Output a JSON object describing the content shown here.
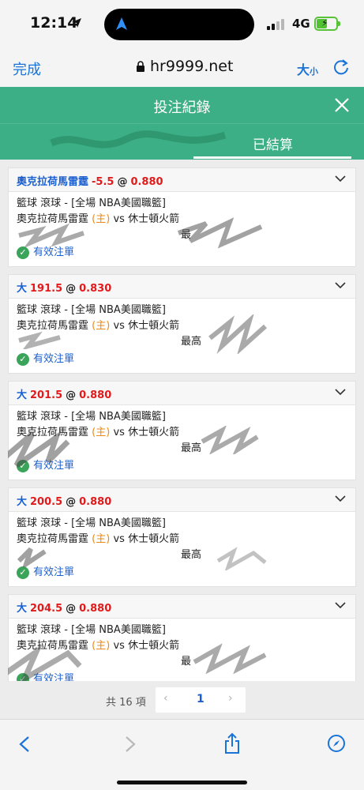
{
  "status": {
    "time": "12:14",
    "network": "4G"
  },
  "browser": {
    "done_label": "完成",
    "url": "hr9999.net",
    "text_size_big": "大",
    "text_size_small": "小"
  },
  "modal": {
    "title": "投注紀錄"
  },
  "tabs": {
    "unsettled": "",
    "settled": "已結算"
  },
  "bets": [
    {
      "pick": "奧克拉荷馬雷霆",
      "line": "-5.5",
      "at": "@",
      "odds": "0.880",
      "league": "籃球 滾球 - [全場 NBA美國職籃]",
      "home": "奧克拉荷馬雷霆",
      "home_tag": "(主)",
      "vs": "vs",
      "away": "休士頓火箭",
      "max": "最",
      "status": "有效注單"
    },
    {
      "pick": "大",
      "line": "191.5",
      "at": "@",
      "odds": "0.830",
      "league": "籃球 滾球 - [全場 NBA美國職籃]",
      "home": "奧克拉荷馬雷霆",
      "home_tag": "(主)",
      "vs": "vs",
      "away": "休士頓火箭",
      "max": "最高",
      "status": "有效注單"
    },
    {
      "pick": "大",
      "line": "201.5",
      "at": "@",
      "odds": "0.880",
      "league": "籃球 滾球 - [全場 NBA美國職籃]",
      "home": "奧克拉荷馬雷霆",
      "home_tag": "(主)",
      "vs": "vs",
      "away": "休士頓火箭",
      "max": "最高",
      "status": "有效注單"
    },
    {
      "pick": "大",
      "line": "200.5",
      "at": "@",
      "odds": "0.880",
      "league": "籃球 滾球 - [全場 NBA美國職籃]",
      "home": "奧克拉荷馬雷霆",
      "home_tag": "(主)",
      "vs": "vs",
      "away": "休士頓火箭",
      "max": "最高",
      "status": "有效注單"
    },
    {
      "pick": "大",
      "line": "204.5",
      "at": "@",
      "odds": "0.880",
      "league": "籃球 滾球 - [全場 NBA美國職籃]",
      "home": "奧克拉荷馬雷霆",
      "home_tag": "(主)",
      "vs": "vs",
      "away": "休士頓火箭",
      "max": "最",
      "status": "有效注單"
    }
  ],
  "pager": {
    "total": "共 16 項",
    "prev": "‹",
    "current": "1",
    "next": "›"
  },
  "colors": {
    "accent_green": "#3daf86",
    "link_blue": "#1a73d9",
    "odds_red": "#e11b1b",
    "home_orange": "#e98a1a"
  }
}
